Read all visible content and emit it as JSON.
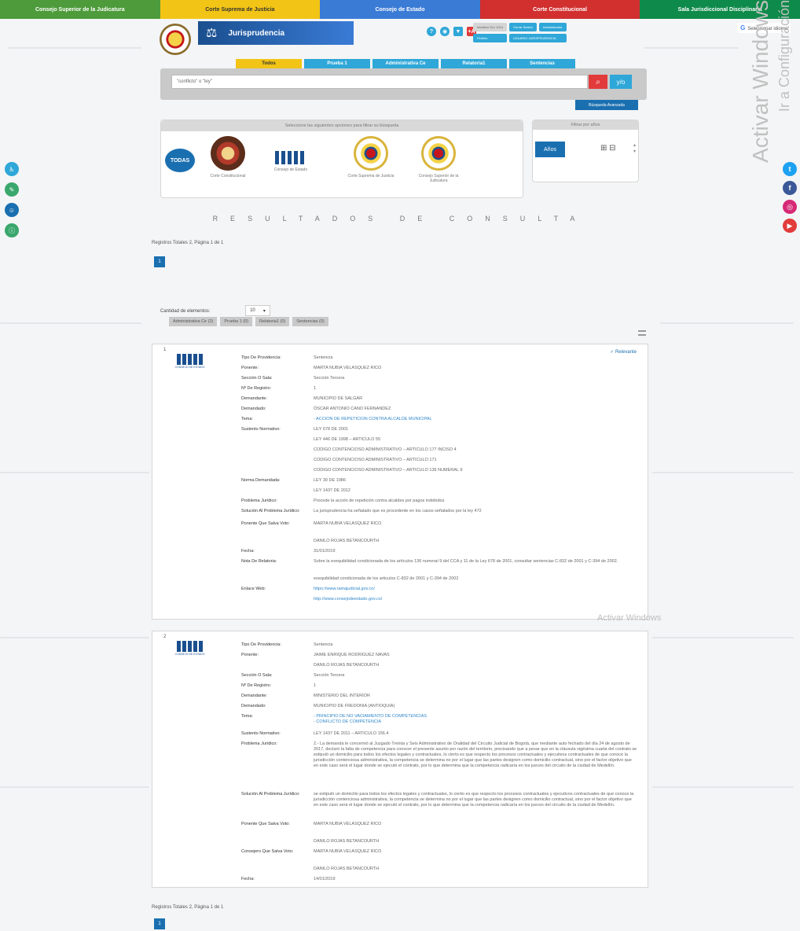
{
  "topbar": [
    {
      "label": "Consejo Superior de la Judicatura",
      "color": "#4d9b3a"
    },
    {
      "label": "Corte Suprema de Justicia",
      "color": "#f2c416"
    },
    {
      "label": "Consejo de Estado",
      "color": "#3a7bd5"
    },
    {
      "label": "Corte Constitucional",
      "color": "#d22f2f"
    },
    {
      "label": "Sala Jurisdiccional Disciplinaria",
      "color": "#0e8a4a"
    }
  ],
  "header": {
    "title": "Jurisprudencia",
    "icons": [
      "?",
      "◉",
      "▼",
      "+A"
    ],
    "buttons": [
      "Inicialice Ecc 1014",
      "Cerrar Sesión",
      "Administrador",
      "Perfiles",
      "USUARIO JURISPRUDENCIA"
    ],
    "translate": "Seleccionar idioma"
  },
  "tabs": [
    "Todos",
    "Prueba 1",
    "Administrativa Ce",
    "Relatoria1",
    "Sentencias"
  ],
  "search": {
    "value": "\"conflicto\" o \"ley\"",
    "yo": "y/o",
    "advanced": "Búsqueda Avanzada"
  },
  "filters": {
    "title": "Seleccione las siguientes opciones para filtrar su búsqueda",
    "todas": "TODAS",
    "entities": [
      "Corte Constitucional",
      "Consejo de Estado",
      "Corte Suprema de Justicia",
      "Consejo Superior de la Judicatura"
    ],
    "years_title": "Filtrar por años",
    "years_btn": "Años"
  },
  "results": {
    "title": "RESULTADOS DE CONSULTA",
    "totals": "Registros Totales 2, Página 1 de 1",
    "page": "1",
    "qty_label": "Cantidad de elementos:",
    "qty_value": "10",
    "filter_tabs": [
      "Administrativa Ce (2)",
      "Prueba 1 (0)",
      "Relatoria1 (0)",
      "Sentencias (0)"
    ]
  },
  "watermark": {
    "line1": "Activar Windows",
    "line2": "Ir a Configuración",
    "inline": "Activar Windows"
  },
  "cards": [
    {
      "num": "1",
      "logo_caption": "CONSEJO DE ESTADO",
      "relevant": "✓ Relevante",
      "rows": [
        [
          "Tipo De Providencia:",
          "Sentencia"
        ],
        [
          "Ponente:",
          "MARTA NUBIA VELASQUEZ RICO"
        ],
        [
          "Sección O Sala:",
          "Sección Tercera"
        ],
        [
          "Nº De Registro:",
          "1"
        ],
        [
          "Demandante:",
          "MUNICIPIO DE SALGAR"
        ],
        [
          "Demandado:",
          "ÓSCAR ANTONIO CANO FERNANDEZ"
        ],
        [
          "Tema:",
          "- ACCION DE REPETICION CONTRA ALCALDE MUNICIPAL"
        ],
        [
          "Sustento Normativo:",
          "LEY 678 DE 2001"
        ],
        [
          "",
          "LEY 446 DE 1998 – ARTICULO 55"
        ],
        [
          "",
          "CODIGO CONTENCIOSO ADMINISTRATIVO – ARTICULO 177 INCISO 4"
        ],
        [
          "",
          "CODIGO CONTENCIOSO ADMINISTRATIVO – ARTICULO 171"
        ],
        [
          "",
          "CODIGO CONTENCIOSO ADMINISTRATIVO – ARTICULO 136 NUMERAL 9"
        ],
        [
          "Norma Demandada:",
          "LEY 30 DE 1986"
        ],
        [
          "",
          "LEY 1437 DE 2012"
        ],
        [
          "Problema Jurídico:",
          "Procede la acción de repetición contra alcaldes por pagos indebidos"
        ],
        [
          "Solución Al Problema Jurídico:",
          "La jurisprudencia ha señalado que es procedente en los casos señalados por la ley 472"
        ],
        [
          "Ponente Que Salva Voto:",
          "MARTA NUBIA VELASQUEZ RICO"
        ],
        [
          "",
          "DANILO ROJAS BETANCOURTH"
        ],
        [
          "Fecha:",
          "31/01/2019"
        ],
        [
          "Nota De Relatoria:",
          "Sobre la exequibilidad condicionada de los artículos 136 numeral 9 del CCA y 11 de la Ley 678 de 2001, consultar sentencias C-832 de 2001 y C-394 de 2002."
        ],
        [
          "",
          "exequibilidad condicionada de los articulos C-832 de 2001 y C-394 de 2002"
        ],
        [
          "Enlace Web:",
          "https://www.ramajudicial.gov.co/"
        ],
        [
          "",
          "http://www.consejodeestado.gov.co/"
        ]
      ]
    },
    {
      "num": "2",
      "logo_caption": "CONSEJO DE ESTADO",
      "rows": [
        [
          "Tipo De Providencia:",
          "Sentencia"
        ],
        [
          "Ponente:",
          "JAIME ENRIQUE RODRIGUEZ NAVAS"
        ],
        [
          "",
          "DANILO ROJAS BETANCOURTH"
        ],
        [
          "Sección O Sala:",
          "Sección Tercera"
        ],
        [
          "Nº De Registro:",
          "1"
        ],
        [
          "Demandante:",
          "MINISTERIO DEL INTERIOR"
        ],
        [
          "Demandado:",
          "MUNICIPIO DE FREDONIA (ANTIOQUIA)"
        ],
        [
          "Tema:",
          "- PRINCIPIO DE NO VACIAMIENTO DE COMPETENCIAS\n- CONFLICTO DE COMPETENCIA"
        ],
        [
          "Sustento Normativo:",
          "LEY 1437 DE 2011 – ARTICULO 156.4"
        ],
        [
          "Problema Jurídico:",
          "2.- La demanda le concernió al Juzgado Treinta y Seis Administrativo de Oralidad del Circuito Judicial de Bogotá, que mediante auto fechado del día 24 de agosto de 2017, declaró la falta de competencia para conocer el presente asunto por razón del territorio, precisando que a pesar que en la cláusula vigésima cuarta del contrato se estipuló un domicilio para todos los efectos legales y contractuales, lo cierto es que respecto los procesos contractuales y ejecutivos contractuales de que conoce la jurisdicción contenciosa administrativa, la competencia se determina no por el lugar que las partes designen como domicilio contractual, sino por el factor objetivo que en este caso será el lugar donde se ejecutó el contrato, por lo que determina que la competencia radicaría en los jueces del circuito de la ciudad de Medellín."
        ],
        [
          "Solución Al Problema Jurídico:",
          "se estipuló un domicilio para todos los efectos legales y contractuales, lo cierto es que respecto los procesos contractuales y ejecutivos contractuales de que conoce la jurisdicción contenciosa administrativa, la competencia se determina no por el lugar que las partes designen como domicilio contractual, sino por el factor objetivo que en este caso será el lugar donde se ejecutó el contrato, por lo que determina que la competencia radicaría en los jueces del circuito de la ciudad de Medellín."
        ],
        [
          "Ponente Que Salva Voto:",
          "MARTA NUBIA VELASQUEZ RICO"
        ],
        [
          "",
          "DANILO ROJAS BETANCOURTH"
        ],
        [
          "Consejero Que Salva Voto:",
          "MARTA NUBIA VELASQUEZ RICO"
        ],
        [
          "",
          "DANILO ROJAS BETANCOURTH"
        ],
        [
          "Fecha:",
          "14/01/2019"
        ]
      ]
    }
  ]
}
